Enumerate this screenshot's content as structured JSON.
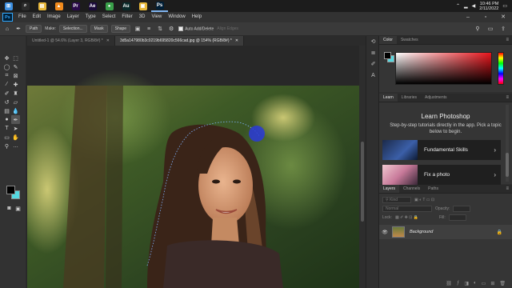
{
  "taskbar": {
    "apps": [
      {
        "name": "windows-start-icon",
        "glyph": "⊞",
        "color": "#3d8fe0"
      },
      {
        "name": "search-icon",
        "glyph": "⌕",
        "color": "#2a2a2a"
      },
      {
        "name": "file-explorer-icon",
        "glyph": "▤",
        "color": "#e8b83a"
      },
      {
        "name": "vlc-icon",
        "glyph": "▲",
        "color": "#f08a1c"
      },
      {
        "name": "premiere-icon",
        "glyph": "Pr",
        "color": "#2a0a4a"
      },
      {
        "name": "after-effects-icon",
        "glyph": "Ae",
        "color": "#1a0a3a"
      },
      {
        "name": "chrome-icon",
        "glyph": "●",
        "color": "#3aa04a"
      },
      {
        "name": "audition-icon",
        "glyph": "Au",
        "color": "#0a2a2a"
      },
      {
        "name": "explorer-window-icon",
        "glyph": "▣",
        "color": "#e8b83a"
      },
      {
        "name": "photoshop-taskbar-icon",
        "glyph": "Ps",
        "color": "#001e36"
      }
    ],
    "time": "10:46 PM",
    "date": "2/11/2022"
  },
  "menubar": {
    "logo": "Ps",
    "items": [
      "File",
      "Edit",
      "Image",
      "Layer",
      "Type",
      "Select",
      "Filter",
      "3D",
      "View",
      "Window",
      "Help"
    ]
  },
  "options": {
    "mode": "Path",
    "make_label": "Make:",
    "selection_btn": "Selection...",
    "mask_btn": "Mask",
    "shape_btn": "Shape",
    "auto_add_delete": "Auto Add/Delete",
    "align_edges": "Align Edges"
  },
  "doc_tabs": [
    {
      "label": "Untitled-1 @ 54.6% (Layer 3, RGB/8#) *",
      "active": false
    },
    {
      "label": "3d5a147980b3c0219b695820c566cad.jpg @ 154% (RGB/8#) *",
      "active": true
    }
  ],
  "color_panel": {
    "tabs": [
      "Color",
      "Swatches"
    ],
    "fg": "#000000",
    "bg": "#55d8e0"
  },
  "learn_panel": {
    "tabs": [
      "Learn",
      "Libraries",
      "Adjustments"
    ],
    "title": "Learn Photoshop",
    "description": "Step-by-step tutorials directly in the app. Pick a topic below to begin.",
    "cards": [
      "Fundamental Skills",
      "Fix a photo"
    ]
  },
  "layers_panel": {
    "tabs": [
      "Layers",
      "Channels",
      "Paths"
    ],
    "kind": "Kind",
    "blend_mode": "Normal",
    "opacity_label": "Opacity:",
    "lock_label": "Lock:",
    "fill_label": "Fill:",
    "layer_name": "Background"
  }
}
